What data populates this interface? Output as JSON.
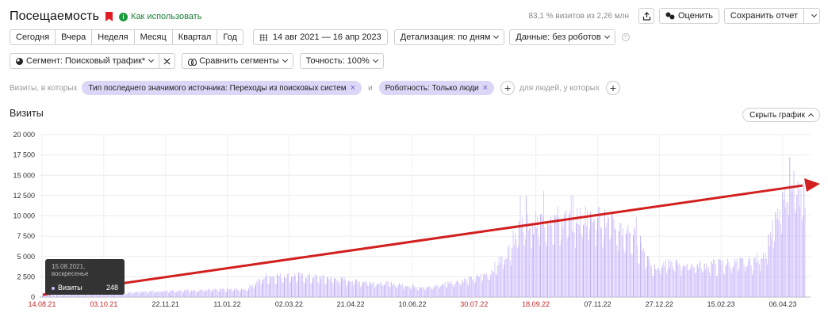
{
  "header": {
    "title": "Посещаемость",
    "howto": "Как использовать",
    "visits_share": "83,1 % визитов из 2,26 млн",
    "rate_label": "Оценить",
    "save_label": "Сохранить отчет"
  },
  "periods": [
    "Сегодня",
    "Вчера",
    "Неделя",
    "Месяц",
    "Квартал",
    "Год"
  ],
  "date_range": "14 авг 2021 — 16 апр 2023",
  "detail": "Детализация: по дням",
  "data_filter": "Данные: без роботов",
  "segment": "Сегмент: Поисковый трафик*",
  "compare": "Сравнить сегменты",
  "accuracy": "Точность: 100%",
  "filters": {
    "prefix": "Визиты, в которых",
    "chip1": "Тип последнего значимого источника: Переходы из поисковых систем",
    "and": "и",
    "chip2": "Роботность: Только люди",
    "people_label": "для людей, у которых"
  },
  "section": {
    "title": "Визиты",
    "hide_chart": "Скрыть график"
  },
  "tooltip": {
    "date": "15.08.2021, воскресенье",
    "metric": "Визиты",
    "value": "248"
  },
  "colors": {
    "bar": "#c9b8ff",
    "bar_dark": "#a996e8",
    "arrow": "#d21f1f",
    "weekend": "#c62828"
  },
  "chart_data": {
    "type": "bar",
    "y_ticks": [
      "0",
      "2 500",
      "5 000",
      "7 500",
      "10 000",
      "12 500",
      "15 000",
      "17 500",
      "20 000"
    ],
    "ylim": [
      0,
      20000
    ],
    "x_ticks": [
      {
        "label": "14.08.21",
        "weekend": true
      },
      {
        "label": "03.10.21",
        "weekend": true
      },
      {
        "label": "22.11.21",
        "weekend": false
      },
      {
        "label": "11.01.22",
        "weekend": false
      },
      {
        "label": "02.03.22",
        "weekend": false
      },
      {
        "label": "21.04.22",
        "weekend": false
      },
      {
        "label": "10.06.22",
        "weekend": false
      },
      {
        "label": "30.07.22",
        "weekend": true
      },
      {
        "label": "18.09.22",
        "weekend": true
      },
      {
        "label": "07.11.22",
        "weekend": false
      },
      {
        "label": "27.12.22",
        "weekend": false
      },
      {
        "label": "15.02.23",
        "weekend": false
      },
      {
        "label": "06.04.23",
        "weekend": false
      }
    ],
    "trend_profile": [
      [
        0,
        250
      ],
      [
        40,
        350
      ],
      [
        80,
        550
      ],
      [
        120,
        800
      ],
      [
        160,
        900
      ],
      [
        200,
        1000
      ],
      [
        220,
        2600
      ],
      [
        250,
        2700
      ],
      [
        280,
        2400
      ],
      [
        310,
        2000
      ],
      [
        340,
        1700
      ],
      [
        380,
        1200
      ],
      [
        400,
        1800
      ],
      [
        420,
        2200
      ],
      [
        440,
        3000
      ],
      [
        460,
        6000
      ],
      [
        470,
        9500
      ],
      [
        480,
        9000
      ],
      [
        500,
        10000
      ],
      [
        520,
        9500
      ],
      [
        540,
        10500
      ],
      [
        560,
        9000
      ],
      [
        580,
        8000
      ],
      [
        595,
        5000
      ],
      [
        600,
        3800
      ],
      [
        620,
        4200
      ],
      [
        650,
        4000
      ],
      [
        680,
        4300
      ],
      [
        700,
        4500
      ],
      [
        710,
        5500
      ],
      [
        720,
        9000
      ],
      [
        730,
        12000
      ],
      [
        735,
        16000
      ],
      [
        740,
        14000
      ],
      [
        745,
        12000
      ],
      [
        750,
        12500
      ]
    ],
    "n_days": 751
  }
}
